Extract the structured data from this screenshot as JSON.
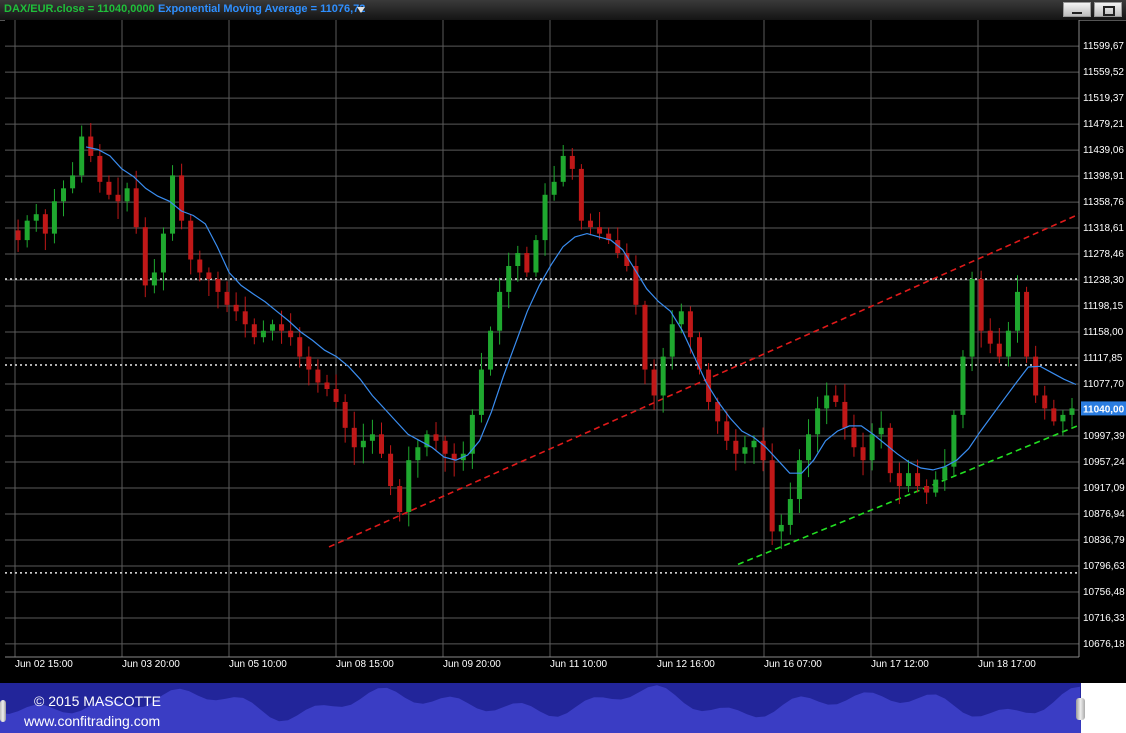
{
  "legend": {
    "close_label": "DAX/EUR.close = 11040,0000",
    "ema_label": "Exponential Moving Average = 11076,72"
  },
  "colors": {
    "up": "#1fa82f",
    "down": "#c01818",
    "ema": "#3a8df0",
    "resistance": "#e01a1a",
    "support": "#22e022",
    "grid": "#5a5a5a",
    "levels": "#e8e8e8",
    "price_tag": "#2a7de1"
  },
  "footer": {
    "copyright": "© 2015 MASCOTTE",
    "website": "www.confitrading.com"
  },
  "chart_data": {
    "type": "candlestick",
    "title": "",
    "ylim": [
      10656,
      11640
    ],
    "y_ticks": [
      "11599,67",
      "11559,52",
      "11519,37",
      "11479,21",
      "11439,06",
      "11398,91",
      "11358,76",
      "11318,61",
      "11278,46",
      "11238,30",
      "11198,15",
      "11158,00",
      "11117,85",
      "11077,70",
      "11037,54",
      "10997,39",
      "10957,24",
      "10917,09",
      "10876,94",
      "10836,79",
      "10796,63",
      "10756,48",
      "10716,33",
      "10676,18"
    ],
    "x_ticks": [
      "Jun 02 15:00",
      "Jun 03 20:00",
      "Jun 05 10:00",
      "Jun 08 15:00",
      "Jun 09 20:00",
      "Jun 11 10:00",
      "Jun 12 16:00",
      "Jun 16 07:00",
      "Jun 17 12:00",
      "Jun 18 17:00"
    ],
    "last_price": "11040,00",
    "horizontal_levels": [
      11240,
      11107,
      10786
    ],
    "close_path": [
      11315,
      11300,
      11330,
      11340,
      11310,
      11360,
      11380,
      11400,
      11460,
      11430,
      11390,
      11370,
      11360,
      11380,
      11320,
      11230,
      11250,
      11310,
      11400,
      11330,
      11270,
      11250,
      11240,
      11220,
      11200,
      11190,
      11170,
      11150,
      11160,
      11170,
      11160,
      11150,
      11120,
      11100,
      11080,
      11070,
      11050,
      11010,
      10980,
      10990,
      11000,
      10970,
      10920,
      10880,
      10960,
      10980,
      11000,
      10990,
      10970,
      10960,
      10970,
      11030,
      11100,
      11160,
      11220,
      11260,
      11280,
      11250,
      11300,
      11370,
      11390,
      11430,
      11410,
      11330,
      11320,
      11310,
      11300,
      11280,
      11260,
      11200,
      11100,
      11060,
      11120,
      11170,
      11190,
      11150,
      11100,
      11050,
      11020,
      10990,
      10970,
      10980,
      10990,
      10960,
      10850,
      10860,
      10900,
      10960,
      11000,
      11040,
      11060,
      11050,
      11010,
      10980,
      10960,
      11000,
      11010,
      10940,
      10920,
      10940,
      10920,
      10910,
      10930,
      10950,
      11030,
      11120,
      11240,
      11160,
      11140,
      11120,
      11160,
      11220,
      11120,
      11060,
      11040,
      11020,
      11030,
      11040
    ],
    "ema_path": [
      11444,
      11440,
      11430,
      11410,
      11398,
      11380,
      11368,
      11360,
      11345,
      11338,
      11325,
      11290,
      11250,
      11230,
      11217,
      11205,
      11190,
      11175,
      11158,
      11145,
      11130,
      11120,
      11105,
      11085,
      11060,
      11040,
      11020,
      11000,
      10990,
      10980,
      10965,
      10960,
      10968,
      10990,
      11035,
      11090,
      11140,
      11190,
      11230,
      11262,
      11290,
      11305,
      11310,
      11305,
      11300,
      11285,
      11255,
      11225,
      11205,
      11190,
      11160,
      11120,
      11080,
      11050,
      11025,
      11005,
      10995,
      10980,
      10960,
      10940,
      10940,
      10960,
      10990,
      11005,
      11013,
      11013,
      11000,
      10985,
      10970,
      10957,
      10948,
      10945,
      10950,
      10960,
      10978,
      11005,
      11030,
      11055,
      11080,
      11104,
      11105,
      11095,
      11085,
      11077
    ],
    "resistance_line": {
      "start": {
        "x": "Jun 08 15:00",
        "y": 10826
      },
      "end": {
        "x": "Jun 18 17:00",
        "y": 11340
      }
    },
    "support_line": {
      "start": {
        "x": "Jun 16 07:00",
        "y": 10799
      },
      "end": {
        "x": "Jun 18 17:00",
        "y": 11014
      }
    }
  }
}
